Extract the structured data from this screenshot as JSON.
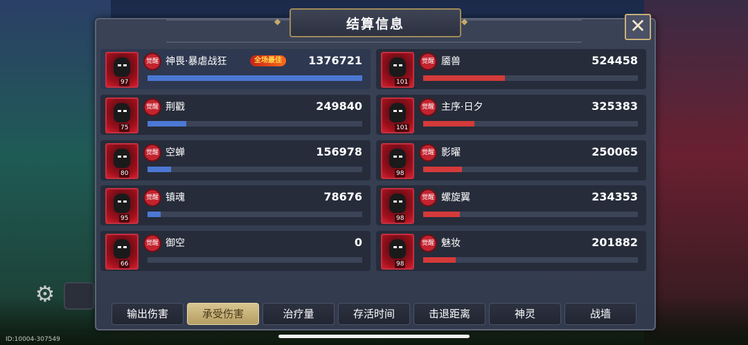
{
  "title": "结算信息",
  "id_label": "ID:10004-307549",
  "close_icon": "close-icon",
  "best_badge": "全场最佳",
  "colors": {
    "left_bar": "#4c78d4",
    "right_bar": "#d43a3a",
    "active_tab": "#d8c690"
  },
  "left_team": [
    {
      "name": "神畏·暴虐战狂",
      "level": "97",
      "value": "1376721",
      "fill": 1.0,
      "best": true
    },
    {
      "name": "荆戳",
      "level": "75",
      "value": "249840",
      "fill": 0.18
    },
    {
      "name": "空蝉",
      "level": "80",
      "value": "156978",
      "fill": 0.11
    },
    {
      "name": "镇魂",
      "level": "95",
      "value": "78676",
      "fill": 0.06
    },
    {
      "name": "御空",
      "level": "66",
      "value": "0",
      "fill": 0.0
    }
  ],
  "right_team": [
    {
      "name": "靥兽",
      "level": "101",
      "value": "524458",
      "fill": 0.38
    },
    {
      "name": "主序·日夕",
      "level": "101",
      "value": "325383",
      "fill": 0.24
    },
    {
      "name": "影曜",
      "level": "98",
      "value": "250065",
      "fill": 0.18
    },
    {
      "name": "螺旋翼",
      "level": "98",
      "value": "234353",
      "fill": 0.17
    },
    {
      "name": "魅妆",
      "level": "98",
      "value": "201882",
      "fill": 0.15
    }
  ],
  "awake_label": "觉醒",
  "tabs": [
    {
      "label": "输出伤害",
      "active": false
    },
    {
      "label": "承受伤害",
      "active": true
    },
    {
      "label": "治疗量",
      "active": false
    },
    {
      "label": "存活时间",
      "active": false
    },
    {
      "label": "击退距离",
      "active": false
    },
    {
      "label": "神灵",
      "active": false
    },
    {
      "label": "战墙",
      "active": false
    }
  ]
}
